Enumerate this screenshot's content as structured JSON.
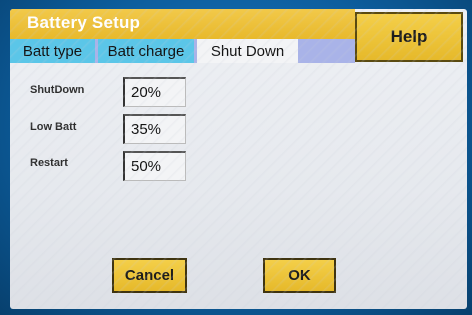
{
  "window": {
    "title": "Battery Setup",
    "help_label": "Help"
  },
  "tabs": [
    {
      "label": "Batt type",
      "selected": false
    },
    {
      "label": "Batt charge",
      "selected": false
    },
    {
      "label": "Shut Down",
      "selected": true
    }
  ],
  "fields": {
    "shutdown": {
      "label": "ShutDown",
      "value": "20%"
    },
    "low_batt": {
      "label": "Low Batt",
      "value": "35%"
    },
    "restart": {
      "label": "Restart",
      "value": "50%"
    }
  },
  "actions": {
    "cancel_label": "Cancel",
    "ok_label": "OK"
  },
  "colors": {
    "title_bar": "#e8b92b",
    "tab_inactive": "#5bc6e8",
    "tab_strip": "#a9b3e8",
    "button": "#e6b92a",
    "bezel": "#0c5fa0"
  }
}
